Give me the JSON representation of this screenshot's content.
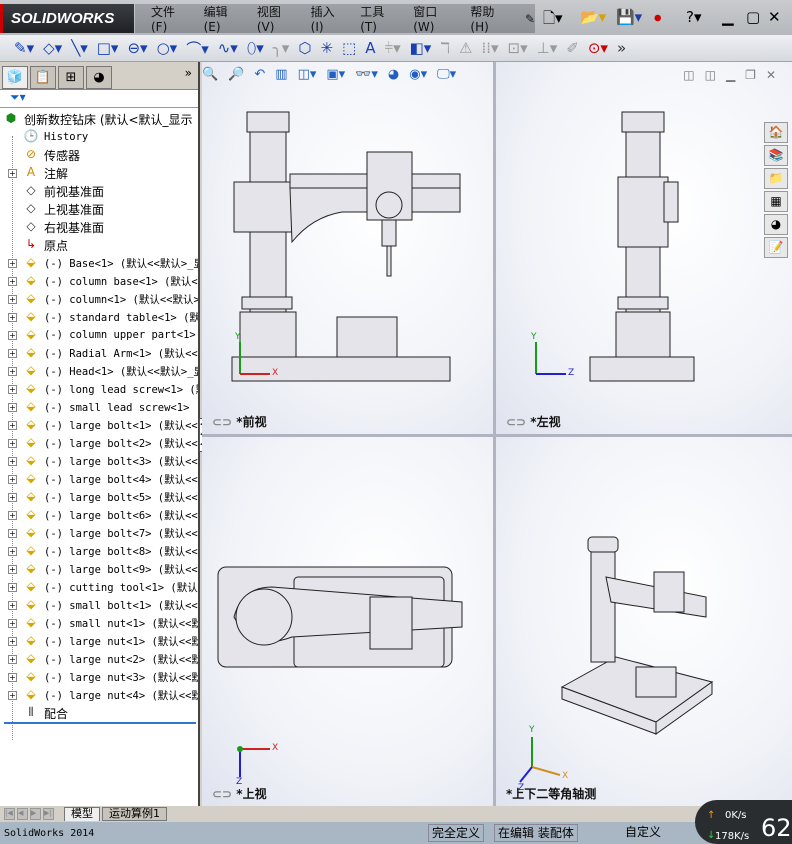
{
  "app": {
    "logo": "SOLIDWORKS",
    "menu": [
      "文件(F)",
      "编辑(E)",
      "视图(V)",
      "插入(I)",
      "工具(T)",
      "窗口(W)",
      "帮助(H)"
    ]
  },
  "toolbar_icons": [
    "smart-dimension",
    "sketch",
    "line",
    "rectangle",
    "slot",
    "circle",
    "arc",
    "spline",
    "ellipse",
    "fillet",
    "polygon",
    "point",
    "offset",
    "text",
    "mirror",
    "convert",
    "trim",
    "linear-pattern",
    "move",
    "repair",
    "relations"
  ],
  "panel": {
    "root": "创新数控钻床  (默认<默认_显示",
    "items": [
      {
        "label": "History",
        "type": "history",
        "expand": false
      },
      {
        "label": "传感器",
        "type": "sensor",
        "expand": false
      },
      {
        "label": "注解",
        "type": "annotation",
        "expand": true
      },
      {
        "label": "前视基准面",
        "type": "plane",
        "expand": false
      },
      {
        "label": "上视基准面",
        "type": "plane",
        "expand": false
      },
      {
        "label": "右视基准面",
        "type": "plane",
        "expand": false
      },
      {
        "label": "原点",
        "type": "origin",
        "expand": false
      },
      {
        "label": "(-) Base<1> (默认<<默认>_显",
        "type": "part",
        "expand": true
      },
      {
        "label": "(-) column base<1> (默认<<",
        "type": "part",
        "expand": true
      },
      {
        "label": "(-) column<1> (默认<<默认>",
        "type": "part",
        "expand": true
      },
      {
        "label": "(-) standard table<1> (默认",
        "type": "part",
        "expand": true
      },
      {
        "label": "(-) column upper part<1> (",
        "type": "part",
        "expand": true
      },
      {
        "label": "(-) Radial Arm<1> (默认<<默",
        "type": "part",
        "expand": true
      },
      {
        "label": "(-) Head<1> (默认<<默认>_显",
        "type": "part",
        "expand": true
      },
      {
        "label": "(-) long lead screw<1> (默",
        "type": "part",
        "expand": true
      },
      {
        "label": "(-) small lead screw<1> (默",
        "type": "part",
        "expand": true
      },
      {
        "label": "(-) large bolt<1> (默认<<默",
        "type": "part",
        "expand": true
      },
      {
        "label": "(-) large bolt<2> (默认<<默",
        "type": "part",
        "expand": true
      },
      {
        "label": "(-) large bolt<3> (默认<<默",
        "type": "part",
        "expand": true
      },
      {
        "label": "(-) large bolt<4> (默认<<默",
        "type": "part",
        "expand": true
      },
      {
        "label": "(-) large bolt<5> (默认<<默",
        "type": "part",
        "expand": true
      },
      {
        "label": "(-) large bolt<6> (默认<<默",
        "type": "part",
        "expand": true
      },
      {
        "label": "(-) large bolt<7> (默认<<默",
        "type": "part",
        "expand": true
      },
      {
        "label": "(-) large bolt<8> (默认<<默",
        "type": "part",
        "expand": true
      },
      {
        "label": "(-) large bolt<9> (默认<<默",
        "type": "part",
        "expand": true
      },
      {
        "label": "(-) cutting tool<1> (默认<",
        "type": "part",
        "expand": true
      },
      {
        "label": "(-) small bolt<1> (默认<<默",
        "type": "part",
        "expand": true
      },
      {
        "label": "(-) small nut<1> (默认<<默认",
        "type": "part",
        "expand": true
      },
      {
        "label": "(-) large nut<1> (默认<<默认",
        "type": "part",
        "expand": true
      },
      {
        "label": "(-) large nut<2> (默认<<默认",
        "type": "part",
        "expand": true
      },
      {
        "label": "(-) large nut<3> (默认<<默认",
        "type": "part",
        "expand": true
      },
      {
        "label": "(-) large nut<4> (默认<<默认",
        "type": "part",
        "expand": true
      },
      {
        "label": "配合",
        "type": "mates",
        "expand": false
      }
    ]
  },
  "viewports": [
    {
      "name": "*前视",
      "axes": [
        "Y",
        "X"
      ]
    },
    {
      "name": "*左视",
      "axes": [
        "Y",
        "Z"
      ]
    },
    {
      "name": "*上视",
      "axes": [
        "X",
        "Z"
      ]
    },
    {
      "name": "*上下二等角轴测",
      "axes": [
        "Y",
        "X",
        "Z"
      ]
    }
  ],
  "bottom_tabs": [
    "模型",
    "运动算例1"
  ],
  "status": {
    "app": "SolidWorks 2014",
    "defined": "完全定义",
    "editing": "在编辑 装配体",
    "custom": "自定义"
  },
  "network": {
    "up": "0K/s",
    "down": "178K/s",
    "percent": "62"
  }
}
